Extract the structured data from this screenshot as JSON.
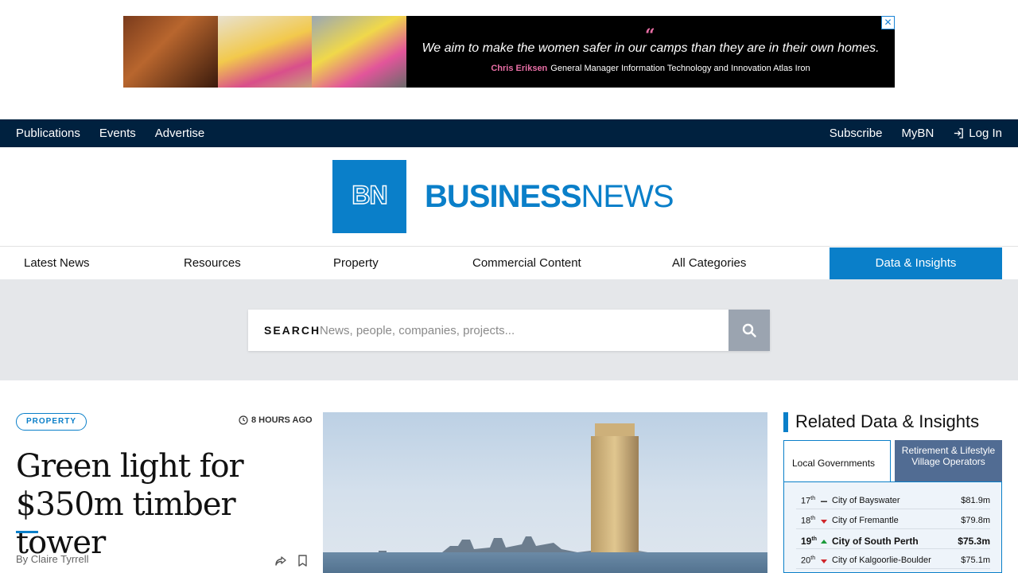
{
  "ad": {
    "headline": "We aim to make the women safer in our camps than they are in their own homes.",
    "credit_name": "Chris Eriksen",
    "credit_role": "General Manager Information Technology and Innovation Atlas Iron",
    "quote_mark": "“",
    "close": "✕"
  },
  "topnav": {
    "left": [
      "Publications",
      "Events",
      "Advertise"
    ],
    "right": [
      "Subscribe",
      "MyBN"
    ],
    "login": "Log In"
  },
  "logo": {
    "mark": "BN",
    "word_bold": "BUSINESS",
    "word_light": "NEWS"
  },
  "mainnav": {
    "items": [
      "Latest News",
      "Resources",
      "Property",
      "Commercial Content",
      "All Categories"
    ],
    "highlight": "Data & Insights"
  },
  "search": {
    "label": "SEARCH",
    "placeholder": "News, people, companies, projects..."
  },
  "article": {
    "category": "PROPERTY",
    "time": "8 HOURS AGO",
    "headline": "Green light for $350m timber tower",
    "byline": "By Claire Tyrrell"
  },
  "related": {
    "title": "Related Data & Insights",
    "tabs": [
      "Local Governments",
      "Retirement & Lifestyle Village Operators"
    ],
    "rows": [
      {
        "rank": "17",
        "suffix": "th",
        "trend": "same",
        "name": "City of Bayswater",
        "value": "$81.9m",
        "highlight": false
      },
      {
        "rank": "18",
        "suffix": "th",
        "trend": "down",
        "name": "City of Fremantle",
        "value": "$79.8m",
        "highlight": false
      },
      {
        "rank": "19",
        "suffix": "th",
        "trend": "up",
        "name": "City of South Perth",
        "value": "$75.3m",
        "highlight": true
      },
      {
        "rank": "20",
        "suffix": "th",
        "trend": "down",
        "name": "City of Kalgoorlie-Boulder",
        "value": "$75.1m",
        "highlight": false
      }
    ]
  },
  "colors": {
    "navy": "#00213f",
    "brand_blue": "#0a7fc9",
    "tab_inactive": "#516c93",
    "up": "#1a9a3a",
    "down": "#d0262b"
  }
}
